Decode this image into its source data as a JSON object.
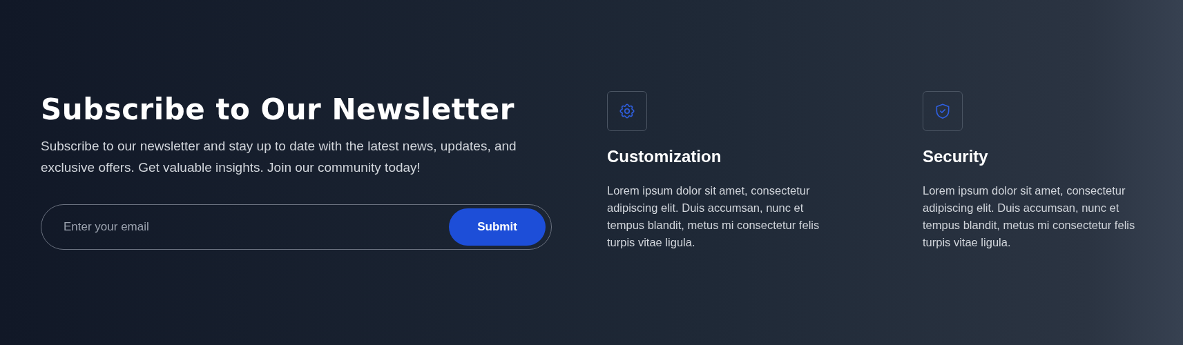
{
  "newsletter": {
    "title": "Subscribe to Our Newsletter",
    "description": "Subscribe to our newsletter and stay up to date with the latest news, updates, and exclusive offers. Get valuable insights. Join our community today!",
    "email_field": {
      "placeholder": "Enter your email"
    },
    "submit_button": "Submit"
  },
  "features": [
    {
      "kind": "gear",
      "title": "Customization",
      "text": "Lorem ipsum dolor sit amet, consectetur adipiscing elit. Duis accumsan, nunc et tempus blandit, metus mi consectetur felis turpis vitae ligula."
    },
    {
      "kind": "shield",
      "title": "Security",
      "text": "Lorem ipsum dolor sit amet, consectetur adipiscing elit. Duis accumsan, nunc et tempus blandit, metus mi consectetur felis turpis vitae ligula."
    }
  ]
}
